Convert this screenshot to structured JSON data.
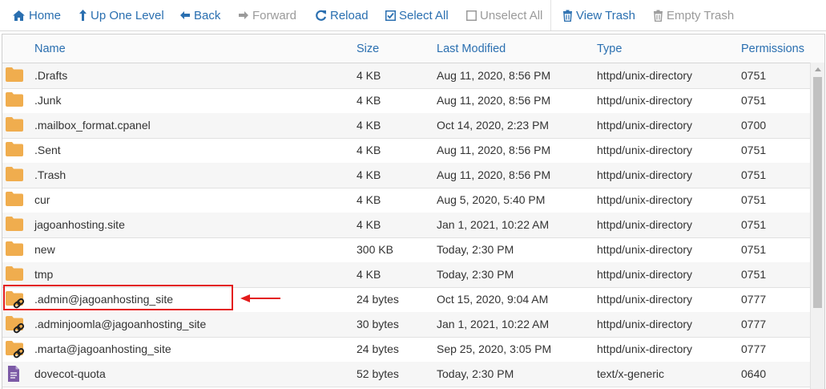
{
  "toolbar": {
    "home": "Home",
    "up": "Up One Level",
    "back": "Back",
    "forward": "Forward",
    "reload": "Reload",
    "select_all": "Select All",
    "unselect_all": "Unselect All",
    "view_trash": "View Trash",
    "empty_trash": "Empty Trash"
  },
  "columns": {
    "name": "Name",
    "size": "Size",
    "modified": "Last Modified",
    "type": "Type",
    "permissions": "Permissions"
  },
  "files": [
    {
      "name": ".Drafts",
      "size": "4 KB",
      "modified": "Aug 11, 2020, 8:56 PM",
      "type": "httpd/unix-directory",
      "perm": "0751",
      "icon": "folder-icon"
    },
    {
      "name": ".Junk",
      "size": "4 KB",
      "modified": "Aug 11, 2020, 8:56 PM",
      "type": "httpd/unix-directory",
      "perm": "0751",
      "icon": "folder-icon"
    },
    {
      "name": ".mailbox_format.cpanel",
      "size": "4 KB",
      "modified": "Oct 14, 2020, 2:23 PM",
      "type": "httpd/unix-directory",
      "perm": "0700",
      "icon": "folder-icon"
    },
    {
      "name": ".Sent",
      "size": "4 KB",
      "modified": "Aug 11, 2020, 8:56 PM",
      "type": "httpd/unix-directory",
      "perm": "0751",
      "icon": "folder-icon"
    },
    {
      "name": ".Trash",
      "size": "4 KB",
      "modified": "Aug 11, 2020, 8:56 PM",
      "type": "httpd/unix-directory",
      "perm": "0751",
      "icon": "folder-icon"
    },
    {
      "name": "cur",
      "size": "4 KB",
      "modified": "Aug 5, 2020, 5:40 PM",
      "type": "httpd/unix-directory",
      "perm": "0751",
      "icon": "folder-icon"
    },
    {
      "name": "jagoanhosting.site",
      "size": "4 KB",
      "modified": "Jan 1, 2021, 10:22 AM",
      "type": "httpd/unix-directory",
      "perm": "0751",
      "icon": "folder-icon"
    },
    {
      "name": "new",
      "size": "300 KB",
      "modified": "Today, 2:30 PM",
      "type": "httpd/unix-directory",
      "perm": "0751",
      "icon": "folder-icon"
    },
    {
      "name": "tmp",
      "size": "4 KB",
      "modified": "Today, 2:30 PM",
      "type": "httpd/unix-directory",
      "perm": "0751",
      "icon": "folder-icon"
    },
    {
      "name": ".admin@jagoanhosting_site",
      "size": "24 bytes",
      "modified": "Oct 15, 2020, 9:04 AM",
      "type": "httpd/unix-directory",
      "perm": "0777",
      "icon": "folder-link-icon"
    },
    {
      "name": ".adminjoomla@jagoanhosting_site",
      "size": "30 bytes",
      "modified": "Jan 1, 2021, 10:22 AM",
      "type": "httpd/unix-directory",
      "perm": "0777",
      "icon": "folder-link-icon"
    },
    {
      "name": ".marta@jagoanhosting_site",
      "size": "24 bytes",
      "modified": "Sep 25, 2020, 3:05 PM",
      "type": "httpd/unix-directory",
      "perm": "0777",
      "icon": "folder-link-icon"
    },
    {
      "name": "dovecot-quota",
      "size": "52 bytes",
      "modified": "Today, 2:30 PM",
      "type": "text/x-generic",
      "perm": "0640",
      "icon": "text-file-icon"
    }
  ],
  "colors": {
    "accent": "#2a6fb0",
    "folder": "#f0ad4e",
    "highlight": "#e31b1b",
    "file": "#7c5aa6"
  }
}
